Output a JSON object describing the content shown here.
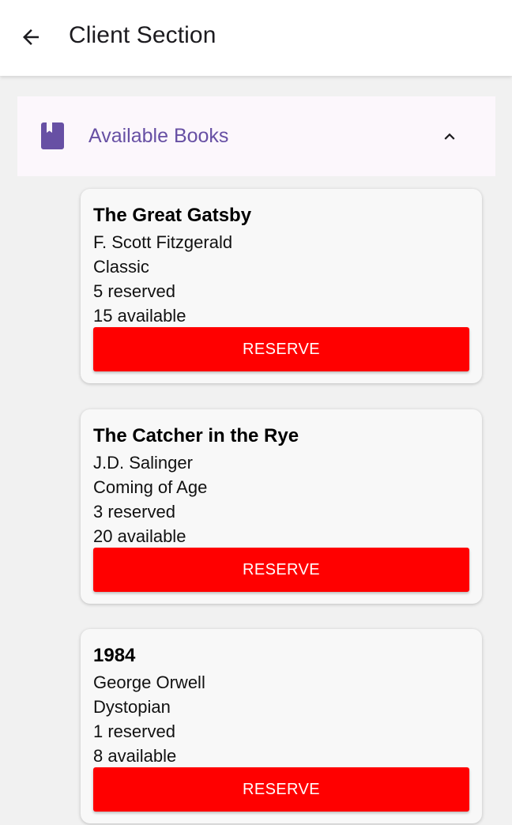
{
  "appbar": {
    "title": "Client Section",
    "back_icon": "arrow-back-icon"
  },
  "section": {
    "label": "Available Books",
    "icon": "book-icon",
    "expand_icon": "chevron-up-icon",
    "accent_color": "#6750a4"
  },
  "books": [
    {
      "title": "The Great Gatsby",
      "author": "F. Scott Fitzgerald",
      "genre": "Classic",
      "reserved": "5 reserved",
      "available": "15 available",
      "button_label": "RESERVE"
    },
    {
      "title": "The Catcher in the Rye",
      "author": "J.D. Salinger",
      "genre": "Coming of Age",
      "reserved": "3 reserved",
      "available": "20 available",
      "button_label": "RESERVE"
    },
    {
      "title": "1984",
      "author": "George Orwell",
      "genre": "Dystopian",
      "reserved": "1 reserved",
      "available": "8 available",
      "button_label": "RESERVE"
    }
  ],
  "colors": {
    "reserve_button": "#ff0000",
    "background": "#f1f1f1"
  }
}
